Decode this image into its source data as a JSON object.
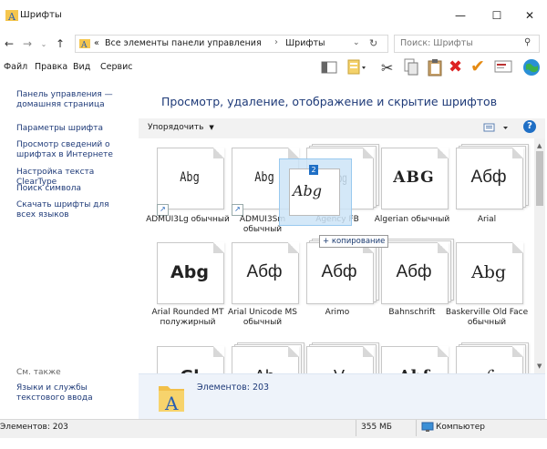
{
  "window": {
    "title": "Шрифты",
    "min_icon": "—",
    "max_icon": "☐",
    "close_icon": "✕"
  },
  "address": {
    "prefix": "«",
    "crumb1": "Все элементы панели управления",
    "sep": "›",
    "crumb2": "Шрифты",
    "search_placeholder": "Поиск: Шрифты"
  },
  "menu": [
    "Файл",
    "Правка",
    "Вид",
    "Сервис"
  ],
  "left": {
    "links": [
      "Панель управления — домашняя страница",
      "Параметры шрифта",
      "Просмотр сведений о шрифтах в Интернете",
      "Настройка текста ClearType",
      "Поиск символа",
      "Скачать шрифты для всех языков"
    ],
    "see_also": "См. также",
    "see_also_link": "Языки и службы текстового ввода"
  },
  "main": {
    "heading": "Просмотр, удаление, отображение и скрытие шрифтов",
    "organize": "Упорядочить",
    "help": "?"
  },
  "fonts": [
    {
      "sample": "Abg",
      "name": "ADMUI3Lg обычный"
    },
    {
      "sample": "Abg",
      "name": "ADMUI3Sm обычный"
    },
    {
      "sample": "Abg",
      "name": "Agency FB"
    },
    {
      "sample": "ABG",
      "name": "Algerian обычный"
    },
    {
      "sample": "Абф",
      "name": "Arial"
    },
    {
      "sample": "Abg",
      "name": "Arial Rounded MT полужирный"
    },
    {
      "sample": "Абф",
      "name": "Arial Unicode MS обычный"
    },
    {
      "sample": "Абф",
      "name": "Arimo"
    },
    {
      "sample": "Абф",
      "name": "Bahnschrift"
    },
    {
      "sample": "Abg",
      "name": "Baskerville Old Face обычный"
    },
    {
      "sample": "Gl",
      "name": ""
    },
    {
      "sample": "Ab",
      "name": ""
    },
    {
      "sample": "V",
      "name": ""
    },
    {
      "sample": "Abf",
      "name": ""
    },
    {
      "sample": "ℒ",
      "name": ""
    }
  ],
  "drag": {
    "badge": "2",
    "sample": "Abg",
    "tooltip": "+ копирование"
  },
  "details": {
    "count": "Элементов: 203"
  },
  "status": {
    "count": "Элементов: 203",
    "size": "355 МБ",
    "computer": "Компьютер"
  }
}
